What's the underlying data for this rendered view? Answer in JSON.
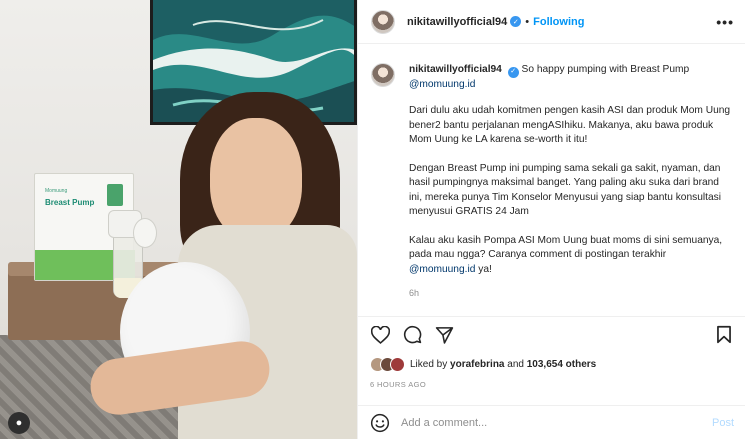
{
  "header": {
    "username": "nikitawillyofficial94",
    "verified_mark": "✓",
    "separator": "•",
    "follow_label": "Following",
    "more_label": "•••"
  },
  "caption": {
    "username": "nikitawillyofficial94",
    "first_line": "So happy pumping with Breast Pump",
    "mention": "@momuung.id",
    "paragraphs": [
      "Dari dulu aku udah komitmen pengen kasih ASI dan produk Mom Uung bener2 bantu perjalanan mengASIhiku. Makanya, aku bawa produk Mom Uung ke LA karena se-worth it itu!",
      "Dengan Breast Pump ini pumping sama sekali ga sakit, nyaman, dan hasil pumpingnya maksimal banget. Yang paling aku suka dari brand ini, mereka punya Tim Konselor Menyusui yang siap bantu konsultasi menyusui GRATIS 24 Jam"
    ],
    "last_paragraph_text": "Kalau aku kasih Pompa ASI Mom Uung buat moms di sini semuanya, pada mau ngga? Caranya comment di postingan terakhir",
    "last_mention": "@momuung.id",
    "last_suffix": " ya!",
    "time": "6h"
  },
  "photo": {
    "box_title": "Breast Pump",
    "box_brand": "Momuung",
    "app_badge": "●"
  },
  "actions": {
    "like": "heart-icon",
    "comment": "comment-icon",
    "share": "share-icon",
    "save": "bookmark-icon"
  },
  "likes": {
    "prefix": "Liked by ",
    "user": "yorafebrina",
    "and": " and ",
    "others": "103,654 others"
  },
  "posted_ago": "6 HOURS AGO",
  "comment_box": {
    "placeholder": "Add a comment...",
    "post_label": "Post"
  },
  "colors": {
    "accent": "#0095f6",
    "verified": "#3897f0",
    "post_disabled": "#b3dbff",
    "muted": "#8e8e8e"
  }
}
